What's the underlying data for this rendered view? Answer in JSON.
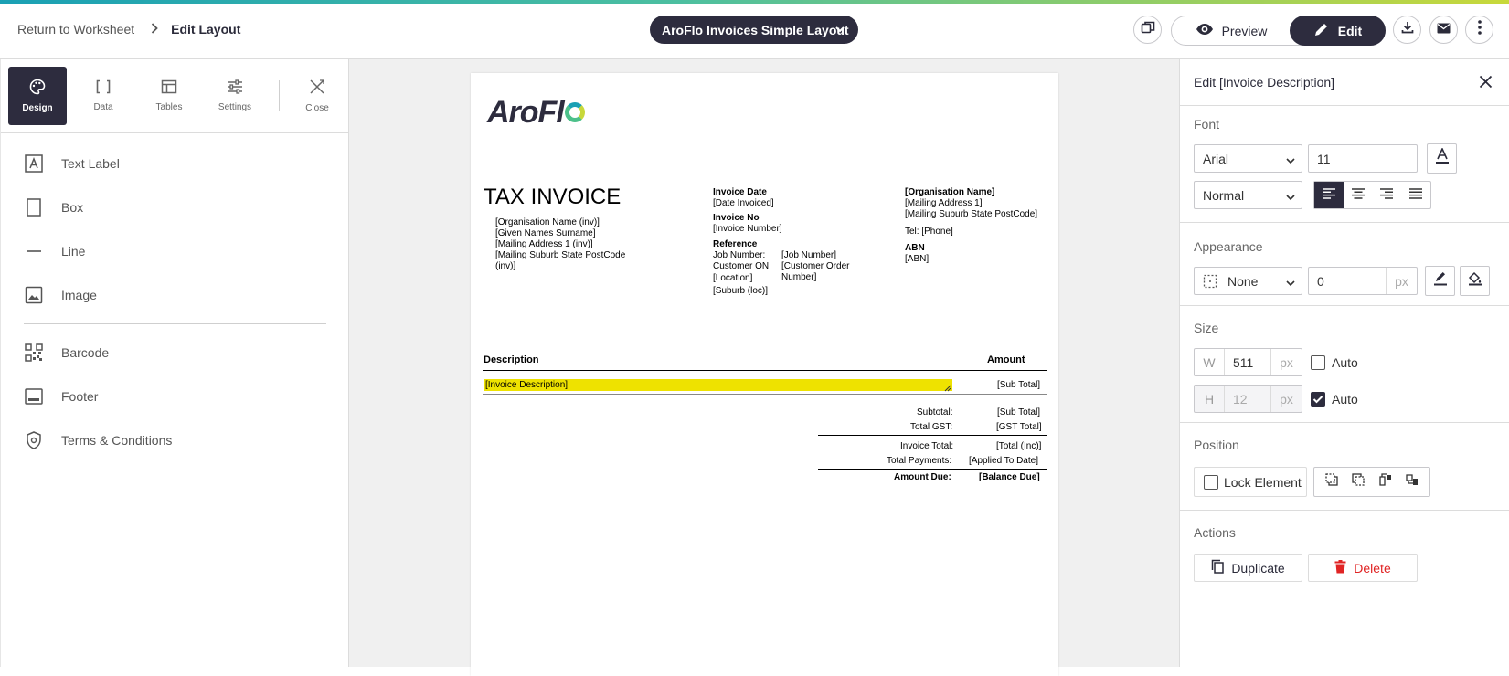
{
  "header": {
    "return_label": "Return to Worksheet",
    "current_page": "Edit Layout",
    "layout_name": "AroFlo Invoices Simple Layout",
    "preview_label": "Preview",
    "edit_label": "Edit"
  },
  "tool_tabs": [
    {
      "label": "Design",
      "icon": "palette-icon",
      "active": true
    },
    {
      "label": "Data",
      "icon": "brackets-icon",
      "active": false
    },
    {
      "label": "Tables",
      "icon": "table-icon",
      "active": false
    },
    {
      "label": "Settings",
      "icon": "sliders-icon",
      "active": false
    },
    {
      "label": "Close",
      "icon": "close-tools-icon",
      "active": false
    }
  ],
  "elements": [
    {
      "label": "Text Label",
      "icon": "text-label-icon"
    },
    {
      "label": "Box",
      "icon": "box-icon"
    },
    {
      "label": "Line",
      "icon": "line-icon"
    },
    {
      "label": "Image",
      "icon": "image-icon"
    },
    {
      "label": "Barcode",
      "icon": "barcode-icon"
    },
    {
      "label": "Footer",
      "icon": "footer-icon"
    },
    {
      "label": "Terms & Conditions",
      "icon": "shield-icon"
    }
  ],
  "document": {
    "logo_text": "AroFl",
    "title": "TAX INVOICE",
    "customer_lines": [
      "[Organisation Name (inv)]",
      "[Given Names Surname]",
      "[Mailing Address 1 (inv)]",
      "[Mailing Suburb State PostCode",
      "(inv)]"
    ],
    "invoice_date_label": "Invoice Date",
    "invoice_date_value": "[Date Invoiced]",
    "invoice_no_label": "Invoice No",
    "invoice_no_value": "[Invoice Number]",
    "reference_label": "Reference",
    "job_number_label": "Job Number:",
    "job_number_value": "[Job Number]",
    "customer_on_label": "Customer ON:",
    "customer_on_value_1": "[Customer Order",
    "customer_on_value_2": "Number]",
    "location": "[Location]",
    "suburb_loc": "[Suburb (loc)]",
    "org_name": "[Organisation Name]",
    "org_address": "[Mailing Address 1]",
    "org_suburb": "[Mailing Suburb State PostCode]",
    "tel": "Tel: [Phone]",
    "abn_label": "ABN",
    "abn_value": "[ABN]",
    "col_description": "Description",
    "col_amount": "Amount",
    "row_description": "[Invoice Description]",
    "row_amount": "[Sub Total]",
    "subtotal_label": "Subtotal:",
    "subtotal_value": "[Sub Total]",
    "gst_label": "Total GST:",
    "gst_value": "[GST Total]",
    "invoice_total_label": "Invoice Total:",
    "invoice_total_value": "[Total (Inc)]",
    "payments_label": "Total Payments:",
    "payments_value": "[Applied To Date]",
    "amount_due_label": "Amount Due:",
    "amount_due_value": "[Balance Due]"
  },
  "panel": {
    "title": "Edit [Invoice Description]",
    "font_label": "Font",
    "font_family": "Arial",
    "font_size": "11",
    "font_weight": "Normal",
    "appearance_label": "Appearance",
    "border_style": "None",
    "border_width": "0",
    "px_unit": "px",
    "size_label": "Size",
    "w_prefix": "W",
    "width": "511",
    "width_auto_label": "Auto",
    "width_auto": false,
    "h_prefix": "H",
    "height": "12",
    "height_auto_label": "Auto",
    "height_auto": true,
    "position_label": "Position",
    "lock_label": "Lock Element",
    "actions_label": "Actions",
    "duplicate_label": "Duplicate",
    "delete_label": "Delete"
  },
  "colors": {
    "accent_dark": "#2d2c3e",
    "highlight": "#eee200",
    "delete_red": "#e02424"
  }
}
